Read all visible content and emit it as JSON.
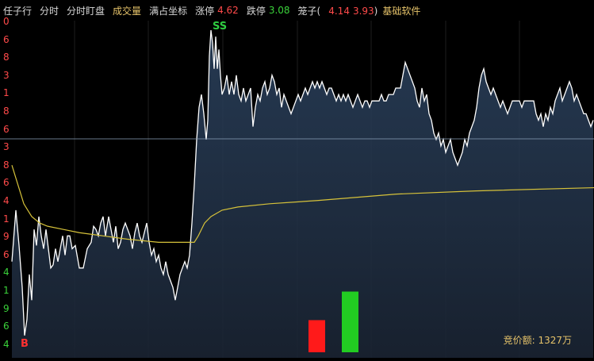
{
  "header": {
    "title": "任子行",
    "tab_fenshi": "分时",
    "tab_dingpan": "分时盯盘",
    "tab_volume": "成交量",
    "tab_fullscale": "满占坐标",
    "limit_up_label": "涨停",
    "limit_up_value": "4.62",
    "limit_down_label": "跌停",
    "limit_down_value": "3.08",
    "cage_label": "笼子(",
    "cage_low": "4.14",
    "cage_high": "3.93",
    "cage_close": ")",
    "software": "基础软件"
  },
  "axis_ticks": [
    {
      "label": "0",
      "color": "#ff4a4a"
    },
    {
      "label": "6",
      "color": "#ff4a4a"
    },
    {
      "label": "8",
      "color": "#ff4a4a"
    },
    {
      "label": "3",
      "color": "#ff4a4a"
    },
    {
      "label": "1",
      "color": "#ff4a4a"
    },
    {
      "label": "8",
      "color": "#ff4a4a"
    },
    {
      "label": "6",
      "color": "#ff4a4a"
    },
    {
      "label": "3",
      "color": "#ff4a4a"
    },
    {
      "label": "8",
      "color": "#ff4a4a"
    },
    {
      "label": "6",
      "color": "#ff4a4a"
    },
    {
      "label": "4",
      "color": "#ff4a4a"
    },
    {
      "label": "1",
      "color": "#ff4a4a"
    },
    {
      "label": "9",
      "color": "#ff4a4a"
    },
    {
      "label": "6",
      "color": "#ff4a4a"
    },
    {
      "label": "4",
      "color": "#3ad23a"
    },
    {
      "label": "1",
      "color": "#3ad23a"
    },
    {
      "label": "9",
      "color": "#3ad23a"
    },
    {
      "label": "6",
      "color": "#3ad23a"
    },
    {
      "label": "4",
      "color": "#3ad23a"
    }
  ],
  "markers": {
    "sell": "SS",
    "buy": "B"
  },
  "bid_amount": "竞价额: 1327万",
  "chart_data": {
    "type": "line",
    "price_series": [
      [
        15,
        0.74
      ],
      [
        20,
        0.58
      ],
      [
        24,
        0.69
      ],
      [
        28,
        0.82
      ],
      [
        31,
        0.97
      ],
      [
        34,
        0.92
      ],
      [
        37,
        0.78
      ],
      [
        40,
        0.86
      ],
      [
        43,
        0.64
      ],
      [
        46,
        0.69
      ],
      [
        49,
        0.6
      ],
      [
        52,
        0.66
      ],
      [
        55,
        0.7
      ],
      [
        58,
        0.64
      ],
      [
        61,
        0.7
      ],
      [
        64,
        0.76
      ],
      [
        67,
        0.75
      ],
      [
        70,
        0.7
      ],
      [
        73,
        0.74
      ],
      [
        76,
        0.7
      ],
      [
        79,
        0.66
      ],
      [
        82,
        0.72
      ],
      [
        85,
        0.66
      ],
      [
        88,
        0.66
      ],
      [
        91,
        0.7
      ],
      [
        95,
        0.69
      ],
      [
        100,
        0.76
      ],
      [
        105,
        0.76
      ],
      [
        110,
        0.7
      ],
      [
        115,
        0.68
      ],
      [
        118,
        0.63
      ],
      [
        121,
        0.64
      ],
      [
        124,
        0.66
      ],
      [
        127,
        0.62
      ],
      [
        130,
        0.6
      ],
      [
        133,
        0.66
      ],
      [
        137,
        0.6
      ],
      [
        140,
        0.64
      ],
      [
        143,
        0.68
      ],
      [
        146,
        0.63
      ],
      [
        149,
        0.7
      ],
      [
        152,
        0.68
      ],
      [
        155,
        0.64
      ],
      [
        158,
        0.62
      ],
      [
        161,
        0.64
      ],
      [
        164,
        0.66
      ],
      [
        167,
        0.7
      ],
      [
        170,
        0.65
      ],
      [
        173,
        0.62
      ],
      [
        176,
        0.66
      ],
      [
        179,
        0.68
      ],
      [
        182,
        0.65
      ],
      [
        185,
        0.62
      ],
      [
        188,
        0.68
      ],
      [
        191,
        0.72
      ],
      [
        194,
        0.7
      ],
      [
        197,
        0.74
      ],
      [
        200,
        0.72
      ],
      [
        203,
        0.76
      ],
      [
        206,
        0.78
      ],
      [
        209,
        0.74
      ],
      [
        212,
        0.78
      ],
      [
        215,
        0.8
      ],
      [
        218,
        0.82
      ],
      [
        221,
        0.86
      ],
      [
        224,
        0.82
      ],
      [
        227,
        0.78
      ],
      [
        230,
        0.76
      ],
      [
        233,
        0.74
      ],
      [
        236,
        0.76
      ],
      [
        239,
        0.72
      ],
      [
        242,
        0.62
      ],
      [
        245,
        0.5
      ],
      [
        248,
        0.36
      ],
      [
        251,
        0.26
      ],
      [
        254,
        0.22
      ],
      [
        257,
        0.28
      ],
      [
        260,
        0.36
      ],
      [
        262,
        0.3
      ],
      [
        264,
        0.1
      ],
      [
        266,
        0.02
      ],
      [
        268,
        0.06
      ],
      [
        270,
        0.14
      ],
      [
        272,
        0.04
      ],
      [
        274,
        0.14
      ],
      [
        276,
        0.08
      ],
      [
        278,
        0.16
      ],
      [
        280,
        0.22
      ],
      [
        283,
        0.2
      ],
      [
        286,
        0.16
      ],
      [
        289,
        0.22
      ],
      [
        292,
        0.18
      ],
      [
        295,
        0.22
      ],
      [
        298,
        0.16
      ],
      [
        301,
        0.22
      ],
      [
        304,
        0.24
      ],
      [
        307,
        0.2
      ],
      [
        310,
        0.24
      ],
      [
        313,
        0.22
      ],
      [
        316,
        0.2
      ],
      [
        319,
        0.32
      ],
      [
        322,
        0.26
      ],
      [
        325,
        0.22
      ],
      [
        328,
        0.24
      ],
      [
        331,
        0.2
      ],
      [
        334,
        0.18
      ],
      [
        337,
        0.22
      ],
      [
        340,
        0.2
      ],
      [
        343,
        0.16
      ],
      [
        346,
        0.18
      ],
      [
        349,
        0.22
      ],
      [
        352,
        0.2
      ],
      [
        355,
        0.26
      ],
      [
        358,
        0.22
      ],
      [
        361,
        0.24
      ],
      [
        364,
        0.26
      ],
      [
        367,
        0.28
      ],
      [
        370,
        0.26
      ],
      [
        373,
        0.24
      ],
      [
        376,
        0.22
      ],
      [
        379,
        0.24
      ],
      [
        382,
        0.22
      ],
      [
        385,
        0.2
      ],
      [
        388,
        0.22
      ],
      [
        391,
        0.2
      ],
      [
        394,
        0.18
      ],
      [
        397,
        0.2
      ],
      [
        400,
        0.18
      ],
      [
        403,
        0.2
      ],
      [
        406,
        0.18
      ],
      [
        409,
        0.2
      ],
      [
        412,
        0.22
      ],
      [
        415,
        0.2
      ],
      [
        418,
        0.2
      ],
      [
        421,
        0.22
      ],
      [
        424,
        0.24
      ],
      [
        427,
        0.22
      ],
      [
        430,
        0.24
      ],
      [
        433,
        0.22
      ],
      [
        436,
        0.24
      ],
      [
        439,
        0.22
      ],
      [
        442,
        0.24
      ],
      [
        445,
        0.26
      ],
      [
        448,
        0.24
      ],
      [
        451,
        0.22
      ],
      [
        454,
        0.24
      ],
      [
        457,
        0.26
      ],
      [
        460,
        0.24
      ],
      [
        463,
        0.24
      ],
      [
        466,
        0.26
      ],
      [
        469,
        0.24
      ],
      [
        472,
        0.24
      ],
      [
        475,
        0.24
      ],
      [
        478,
        0.24
      ],
      [
        481,
        0.22
      ],
      [
        484,
        0.24
      ],
      [
        487,
        0.24
      ],
      [
        490,
        0.22
      ],
      [
        493,
        0.22
      ],
      [
        496,
        0.22
      ],
      [
        499,
        0.2
      ],
      [
        502,
        0.2
      ],
      [
        505,
        0.2
      ],
      [
        508,
        0.16
      ],
      [
        511,
        0.12
      ],
      [
        514,
        0.14
      ],
      [
        517,
        0.16
      ],
      [
        520,
        0.18
      ],
      [
        523,
        0.2
      ],
      [
        526,
        0.24
      ],
      [
        529,
        0.26
      ],
      [
        532,
        0.2
      ],
      [
        535,
        0.24
      ],
      [
        538,
        0.22
      ],
      [
        541,
        0.28
      ],
      [
        544,
        0.3
      ],
      [
        547,
        0.34
      ],
      [
        550,
        0.36
      ],
      [
        553,
        0.34
      ],
      [
        556,
        0.38
      ],
      [
        559,
        0.36
      ],
      [
        562,
        0.4
      ],
      [
        565,
        0.38
      ],
      [
        568,
        0.36
      ],
      [
        571,
        0.4
      ],
      [
        574,
        0.42
      ],
      [
        577,
        0.44
      ],
      [
        580,
        0.42
      ],
      [
        583,
        0.4
      ],
      [
        586,
        0.36
      ],
      [
        589,
        0.38
      ],
      [
        592,
        0.34
      ],
      [
        595,
        0.32
      ],
      [
        598,
        0.3
      ],
      [
        601,
        0.26
      ],
      [
        604,
        0.2
      ],
      [
        607,
        0.16
      ],
      [
        610,
        0.14
      ],
      [
        613,
        0.18
      ],
      [
        616,
        0.2
      ],
      [
        619,
        0.22
      ],
      [
        622,
        0.2
      ],
      [
        625,
        0.22
      ],
      [
        628,
        0.24
      ],
      [
        631,
        0.26
      ],
      [
        634,
        0.24
      ],
      [
        637,
        0.26
      ],
      [
        640,
        0.28
      ],
      [
        643,
        0.26
      ],
      [
        646,
        0.24
      ],
      [
        649,
        0.24
      ],
      [
        652,
        0.24
      ],
      [
        655,
        0.24
      ],
      [
        658,
        0.26
      ],
      [
        661,
        0.24
      ],
      [
        664,
        0.24
      ],
      [
        667,
        0.24
      ],
      [
        670,
        0.24
      ],
      [
        673,
        0.24
      ],
      [
        676,
        0.28
      ],
      [
        679,
        0.3
      ],
      [
        682,
        0.28
      ],
      [
        685,
        0.32
      ],
      [
        688,
        0.28
      ],
      [
        691,
        0.3
      ],
      [
        694,
        0.26
      ],
      [
        697,
        0.28
      ],
      [
        700,
        0.24
      ],
      [
        703,
        0.22
      ],
      [
        706,
        0.2
      ],
      [
        709,
        0.24
      ],
      [
        712,
        0.22
      ],
      [
        715,
        0.2
      ],
      [
        718,
        0.18
      ],
      [
        721,
        0.2
      ],
      [
        724,
        0.24
      ],
      [
        727,
        0.22
      ],
      [
        730,
        0.24
      ],
      [
        733,
        0.26
      ],
      [
        736,
        0.28
      ],
      [
        739,
        0.28
      ],
      [
        742,
        0.3
      ],
      [
        745,
        0.32
      ],
      [
        748,
        0.3
      ]
    ],
    "avg_series": [
      [
        15,
        0.44
      ],
      [
        20,
        0.48
      ],
      [
        25,
        0.52
      ],
      [
        30,
        0.56
      ],
      [
        35,
        0.58
      ],
      [
        40,
        0.6
      ],
      [
        50,
        0.62
      ],
      [
        60,
        0.63
      ],
      [
        80,
        0.64
      ],
      [
        100,
        0.65
      ],
      [
        130,
        0.66
      ],
      [
        160,
        0.67
      ],
      [
        200,
        0.68
      ],
      [
        230,
        0.68
      ],
      [
        245,
        0.68
      ],
      [
        250,
        0.66
      ],
      [
        258,
        0.62
      ],
      [
        266,
        0.6
      ],
      [
        280,
        0.58
      ],
      [
        300,
        0.57
      ],
      [
        340,
        0.56
      ],
      [
        400,
        0.55
      ],
      [
        500,
        0.53
      ],
      [
        600,
        0.52
      ],
      [
        749,
        0.51
      ]
    ],
    "volume_bars": [
      {
        "label": "sell",
        "color": "#ff1a1a",
        "value": 0.45
      },
      {
        "label": "buy",
        "color": "#22cc22",
        "value": 0.85
      }
    ]
  }
}
